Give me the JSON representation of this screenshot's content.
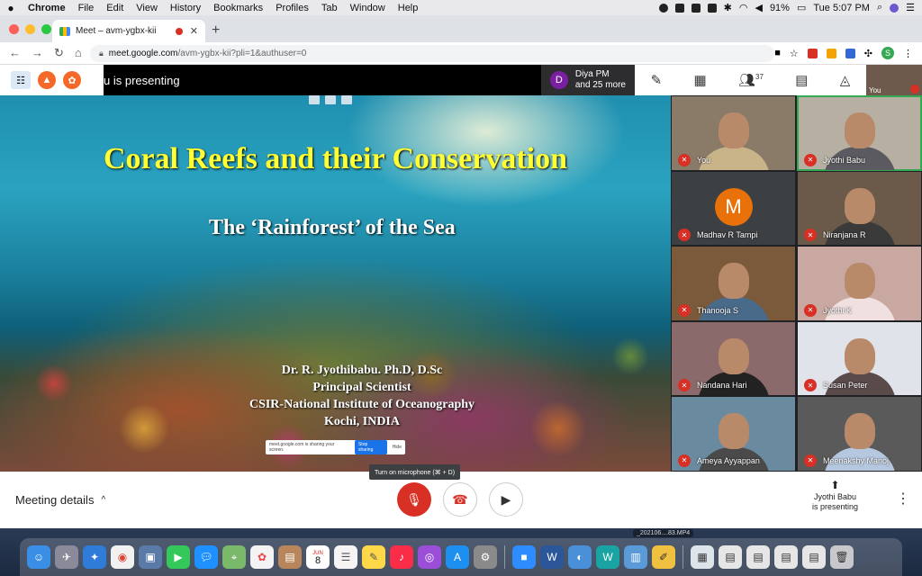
{
  "menubar": {
    "app": "Chrome",
    "items": [
      "File",
      "Edit",
      "View",
      "History",
      "Bookmarks",
      "Profiles",
      "Tab",
      "Window",
      "Help"
    ],
    "battery": "91%",
    "clock": "Tue 5:07 PM"
  },
  "browser": {
    "tab_title": "Meet – avm-ygbx-kii",
    "url_host": "meet.google.com",
    "url_path": "/avm-ygbx-kii?pli=1&authuser=0",
    "profile_initial": "S"
  },
  "meet": {
    "presenting_text": "u is presenting",
    "participant_initial": "D",
    "participant_line1": "Diya PM",
    "participant_line2": "and 25 more",
    "people_count": "37",
    "self_label": "You",
    "slide": {
      "title": "Coral Reefs  and their Conservation",
      "subtitle": "The ‘Rainforest’ of the Sea",
      "author_lines": [
        "Dr. R. Jyothibabu. Ph.D, D.Sc",
        "Principal Scientist",
        "CSIR-National Institute of Oceanography",
        "Kochi, INDIA"
      ],
      "share_text": "meet.google.com is sharing your screen.",
      "stop_label": "Stop sharing",
      "hide_label": "Hide"
    },
    "participants": [
      {
        "name": "You",
        "bg": "#8a7a68",
        "body": "#c9b48a"
      },
      {
        "name": "Jyothi Babu",
        "bg": "#b7b0a2",
        "body": "#5a5a60",
        "active": true
      },
      {
        "name": "Madhav R Tampi",
        "bg": "#3c4043",
        "letter": "M"
      },
      {
        "name": "Niranjana R",
        "bg": "#6b5a4a",
        "body": "#3a3a3a"
      },
      {
        "name": "Thanooja S",
        "bg": "#7a5a3a",
        "body": "#4a6a8a"
      },
      {
        "name": "Jyothi K",
        "bg": "#c8a8a0",
        "body": "#f0e0e0"
      },
      {
        "name": "Nandana Hari",
        "bg": "#8a6a6a",
        "body": "#222"
      },
      {
        "name": "Susan Peter",
        "bg": "#e0e4ea",
        "body": "#5a4a4a"
      },
      {
        "name": "Ameya Ayyappan",
        "bg": "#6a8aa0",
        "body": "#4a4a4a"
      },
      {
        "name": "Meenakshy Manoj",
        "bg": "#5a5a5a",
        "body": "#b6c8e0"
      }
    ],
    "controls": {
      "details_label": "Meeting details",
      "mic_tooltip": "Turn on microphone (⌘ + D)",
      "presenting_line1": "Jyothi Babu",
      "presenting_line2": "is presenting"
    }
  },
  "dock": {
    "download_label": "_202106....83.MP4",
    "calendar_day": "8",
    "calendar_month": "JUN"
  }
}
